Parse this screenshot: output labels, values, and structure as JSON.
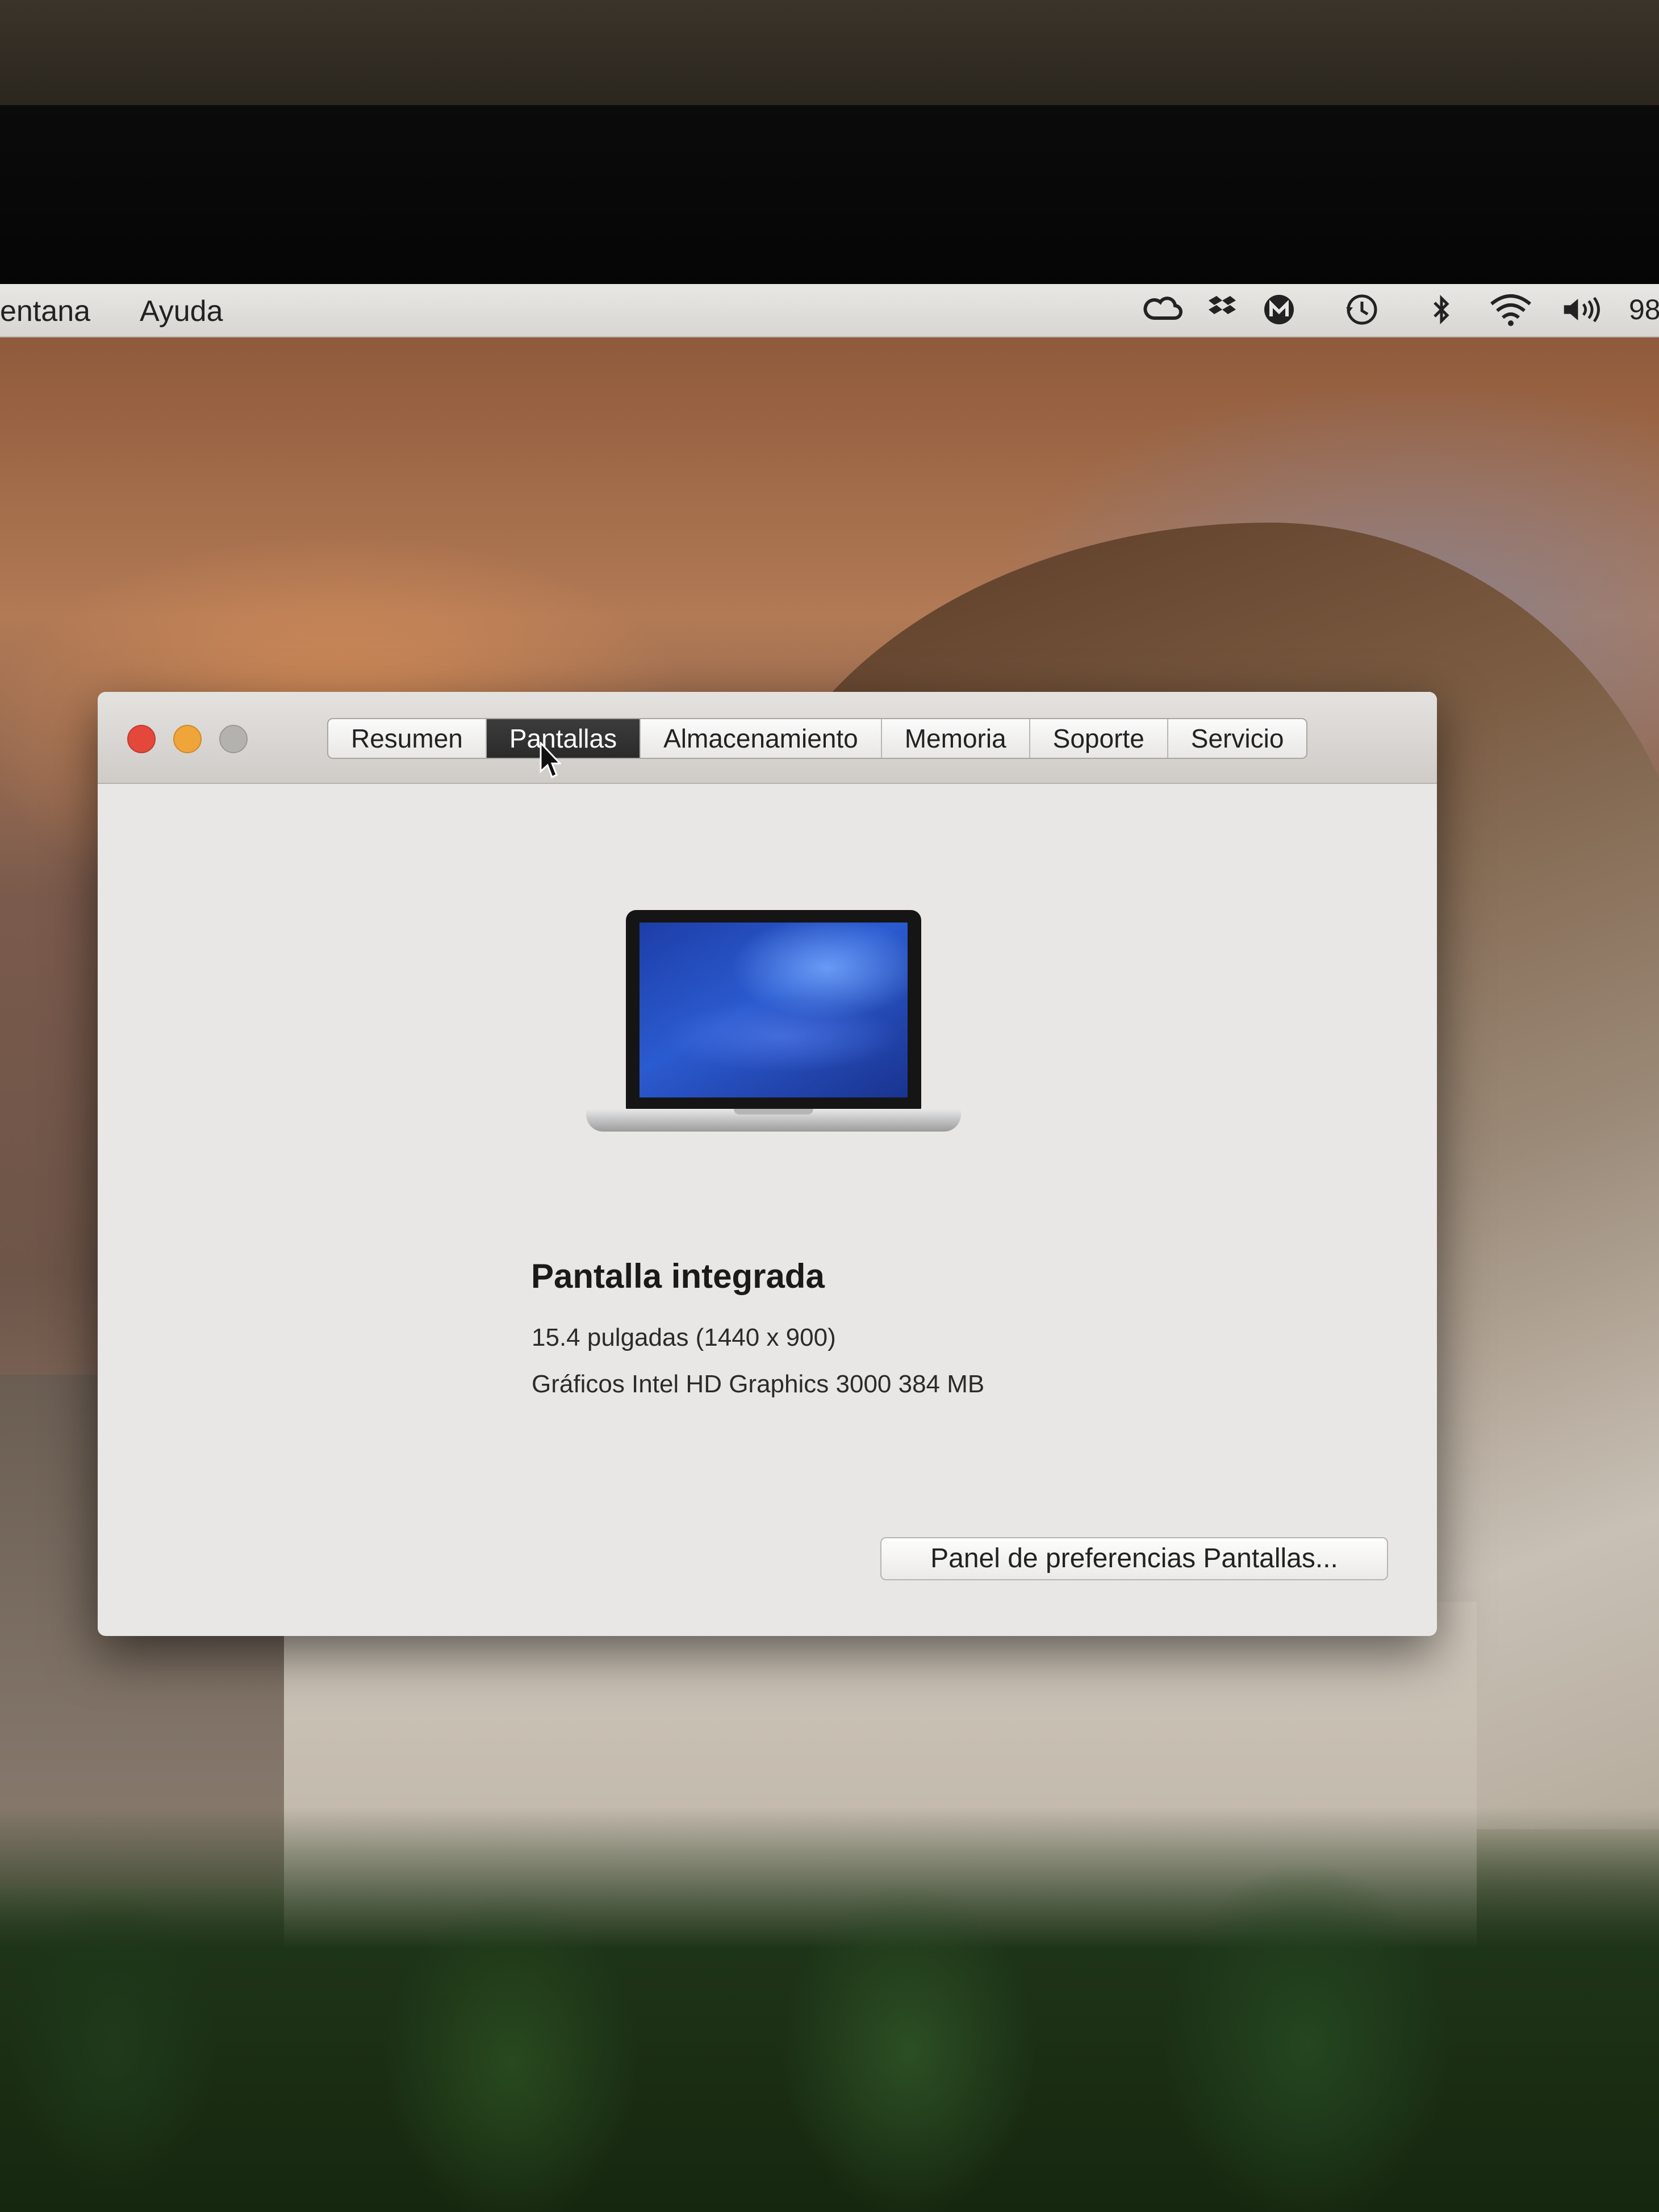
{
  "menubar": {
    "items": [
      "entana",
      "Ayuda"
    ],
    "status_icons": [
      "creative-cloud-icon",
      "dropbox-icon",
      "malwarebytes-icon",
      "time-machine-icon",
      "bluetooth-icon",
      "wifi-icon",
      "volume-icon"
    ],
    "battery_text": "98"
  },
  "window": {
    "tabs": [
      "Resumen",
      "Pantallas",
      "Almacenamiento",
      "Memoria",
      "Soporte",
      "Servicio"
    ],
    "active_tab": "Pantallas",
    "display": {
      "title": "Pantalla integrada",
      "size": "15.4 pulgadas (1440 x 900)",
      "graphics": "Gráficos Intel HD Graphics 3000 384 MB"
    },
    "pref_button_label": "Panel de preferencias Pantallas..."
  }
}
